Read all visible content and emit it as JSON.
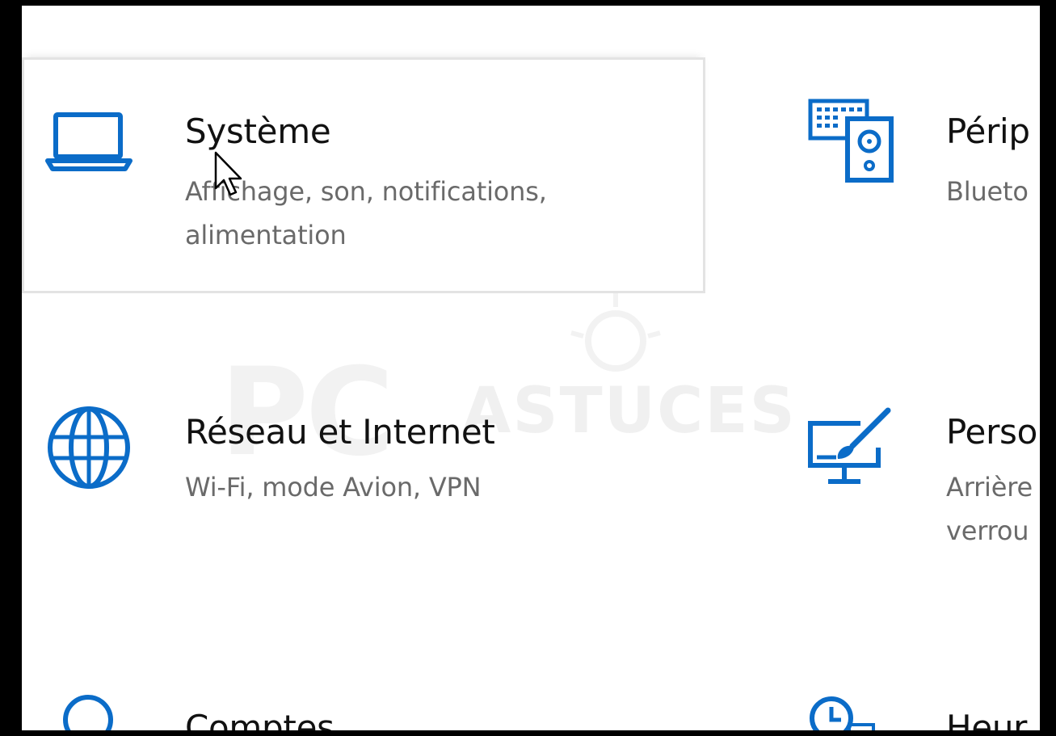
{
  "colors": {
    "accent": "#0b6cc8",
    "title": "#111111",
    "description": "#6a6a6a"
  },
  "categories": [
    {
      "id": "system",
      "icon": "laptop-icon",
      "title": "Système",
      "description_lines": [
        "Affichage, son, notifications,",
        "alimentation"
      ]
    },
    {
      "id": "devices",
      "icon": "keyboard-speaker-icon",
      "title": "Périp",
      "description_lines": [
        "Blueto"
      ]
    },
    {
      "id": "network",
      "icon": "globe-icon",
      "title": "Réseau et Internet",
      "description_lines": [
        "Wi-Fi, mode Avion, VPN"
      ]
    },
    {
      "id": "personalization",
      "icon": "paint-monitor-icon",
      "title": "Perso",
      "description_lines": [
        "Arrière",
        "verrou"
      ]
    },
    {
      "id": "accounts",
      "icon": "person-icon",
      "title": "Comptes",
      "description_lines": []
    },
    {
      "id": "time",
      "icon": "clock-icon",
      "title": "Heur",
      "description_lines": []
    }
  ],
  "watermark": {
    "text_big": "PC",
    "text_small": "ASTUCES"
  }
}
